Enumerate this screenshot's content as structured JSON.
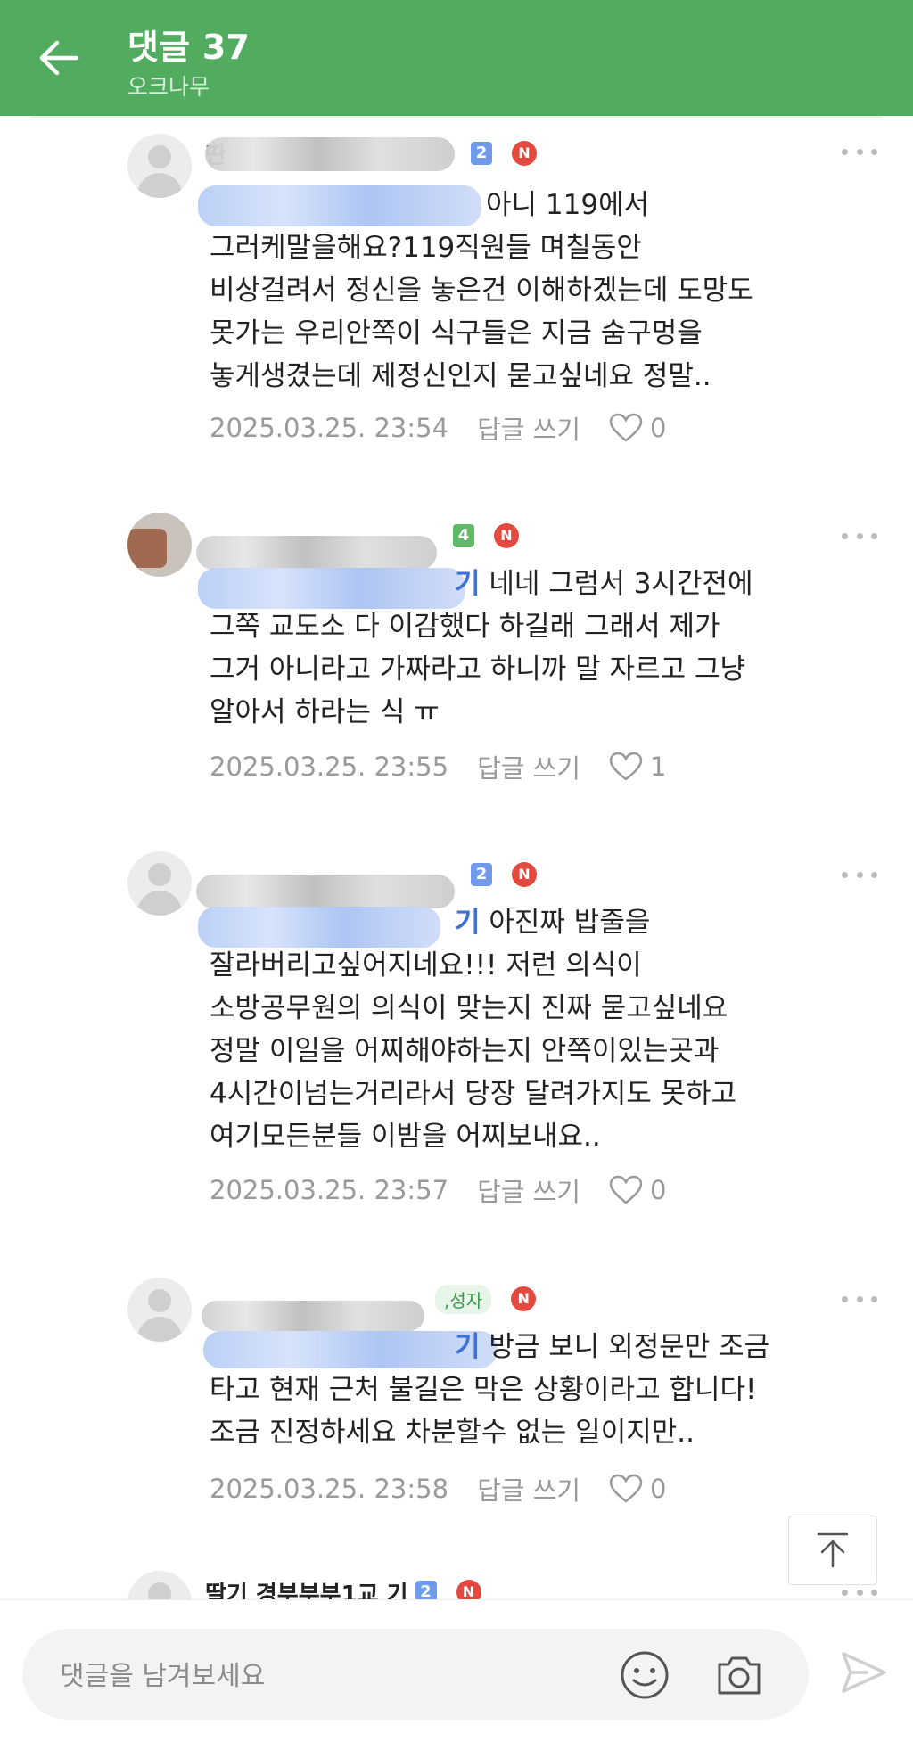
{
  "header": {
    "title": "댓글",
    "count": "37",
    "subtitle": "오크나무",
    "background": "#52ac5f"
  },
  "comments": [
    {
      "author_visible": "딴",
      "level": "2",
      "new_badge": "N",
      "reply_to_visible": "",
      "text": "아니 119에서\n그러케말을해요?119직원들 며칠동안\n비상걸려서 정신을 놓은건 이해하겠는데 도망도\n못가는 우리안쪽이 식구들은 지금 숨구멍을\n놓게생겼는데 제정신인지 묻고싶네요 정말..",
      "date": "2025.03.25. 23:54",
      "reply_label": "답글 쓰기",
      "likes": "0"
    },
    {
      "author_visible": "",
      "level": "4",
      "new_badge": "N",
      "reply_to_visible": "기",
      "text": "네네 그럼서 3시간전에\n그쪽 교도소 다 이감했다 하길래 그래서 제가\n그거 아니라고 가짜라고 하니까 말 자르고 그냥\n알아서 하라는 식 ㅠ",
      "date": "2025.03.25. 23:55",
      "reply_label": "답글 쓰기",
      "likes": "1"
    },
    {
      "author_visible": "",
      "level": "2",
      "new_badge": "N",
      "reply_to_visible": "기",
      "text": "아진짜 밥줄을\n잘라버리고싶어지네요!!! 저런 의식이\n소방공무원의 의식이 맞는지 진짜 묻고싶네요\n정말 이일을 어찌해야하는지 안쪽이있는곳과\n4시간이넘는거리라서 당장 달려가지도 못하고\n여기모든분들 이밤을 어찌보내요..",
      "date": "2025.03.25. 23:57",
      "reply_label": "답글 쓰기",
      "likes": "0"
    },
    {
      "author_visible": "",
      "tag": ",성자",
      "new_badge": "N",
      "reply_to_visible": "기",
      "text": "방금 보니 외정문만 조금\n타고 현재 근처 불길은 막은 상황이라고 합니다!\n조금 진정하세요 차분할수 없는 일이지만..",
      "date": "2025.03.25. 23:58",
      "reply_label": "답글 쓰기",
      "likes": "0"
    },
    {
      "author_visible": "딸기 경부부부1교 기",
      "level": "2",
      "new_badge": "N"
    }
  ],
  "input": {
    "placeholder": "댓글을 남겨보세요"
  },
  "icons": {
    "back": "arrow-left-icon",
    "more": "more-dots-icon",
    "like": "heart-outline-icon",
    "scroll_top": "arrow-up-to-top-icon",
    "emoji": "smiley-icon",
    "camera": "camera-icon",
    "send": "send-icon"
  }
}
